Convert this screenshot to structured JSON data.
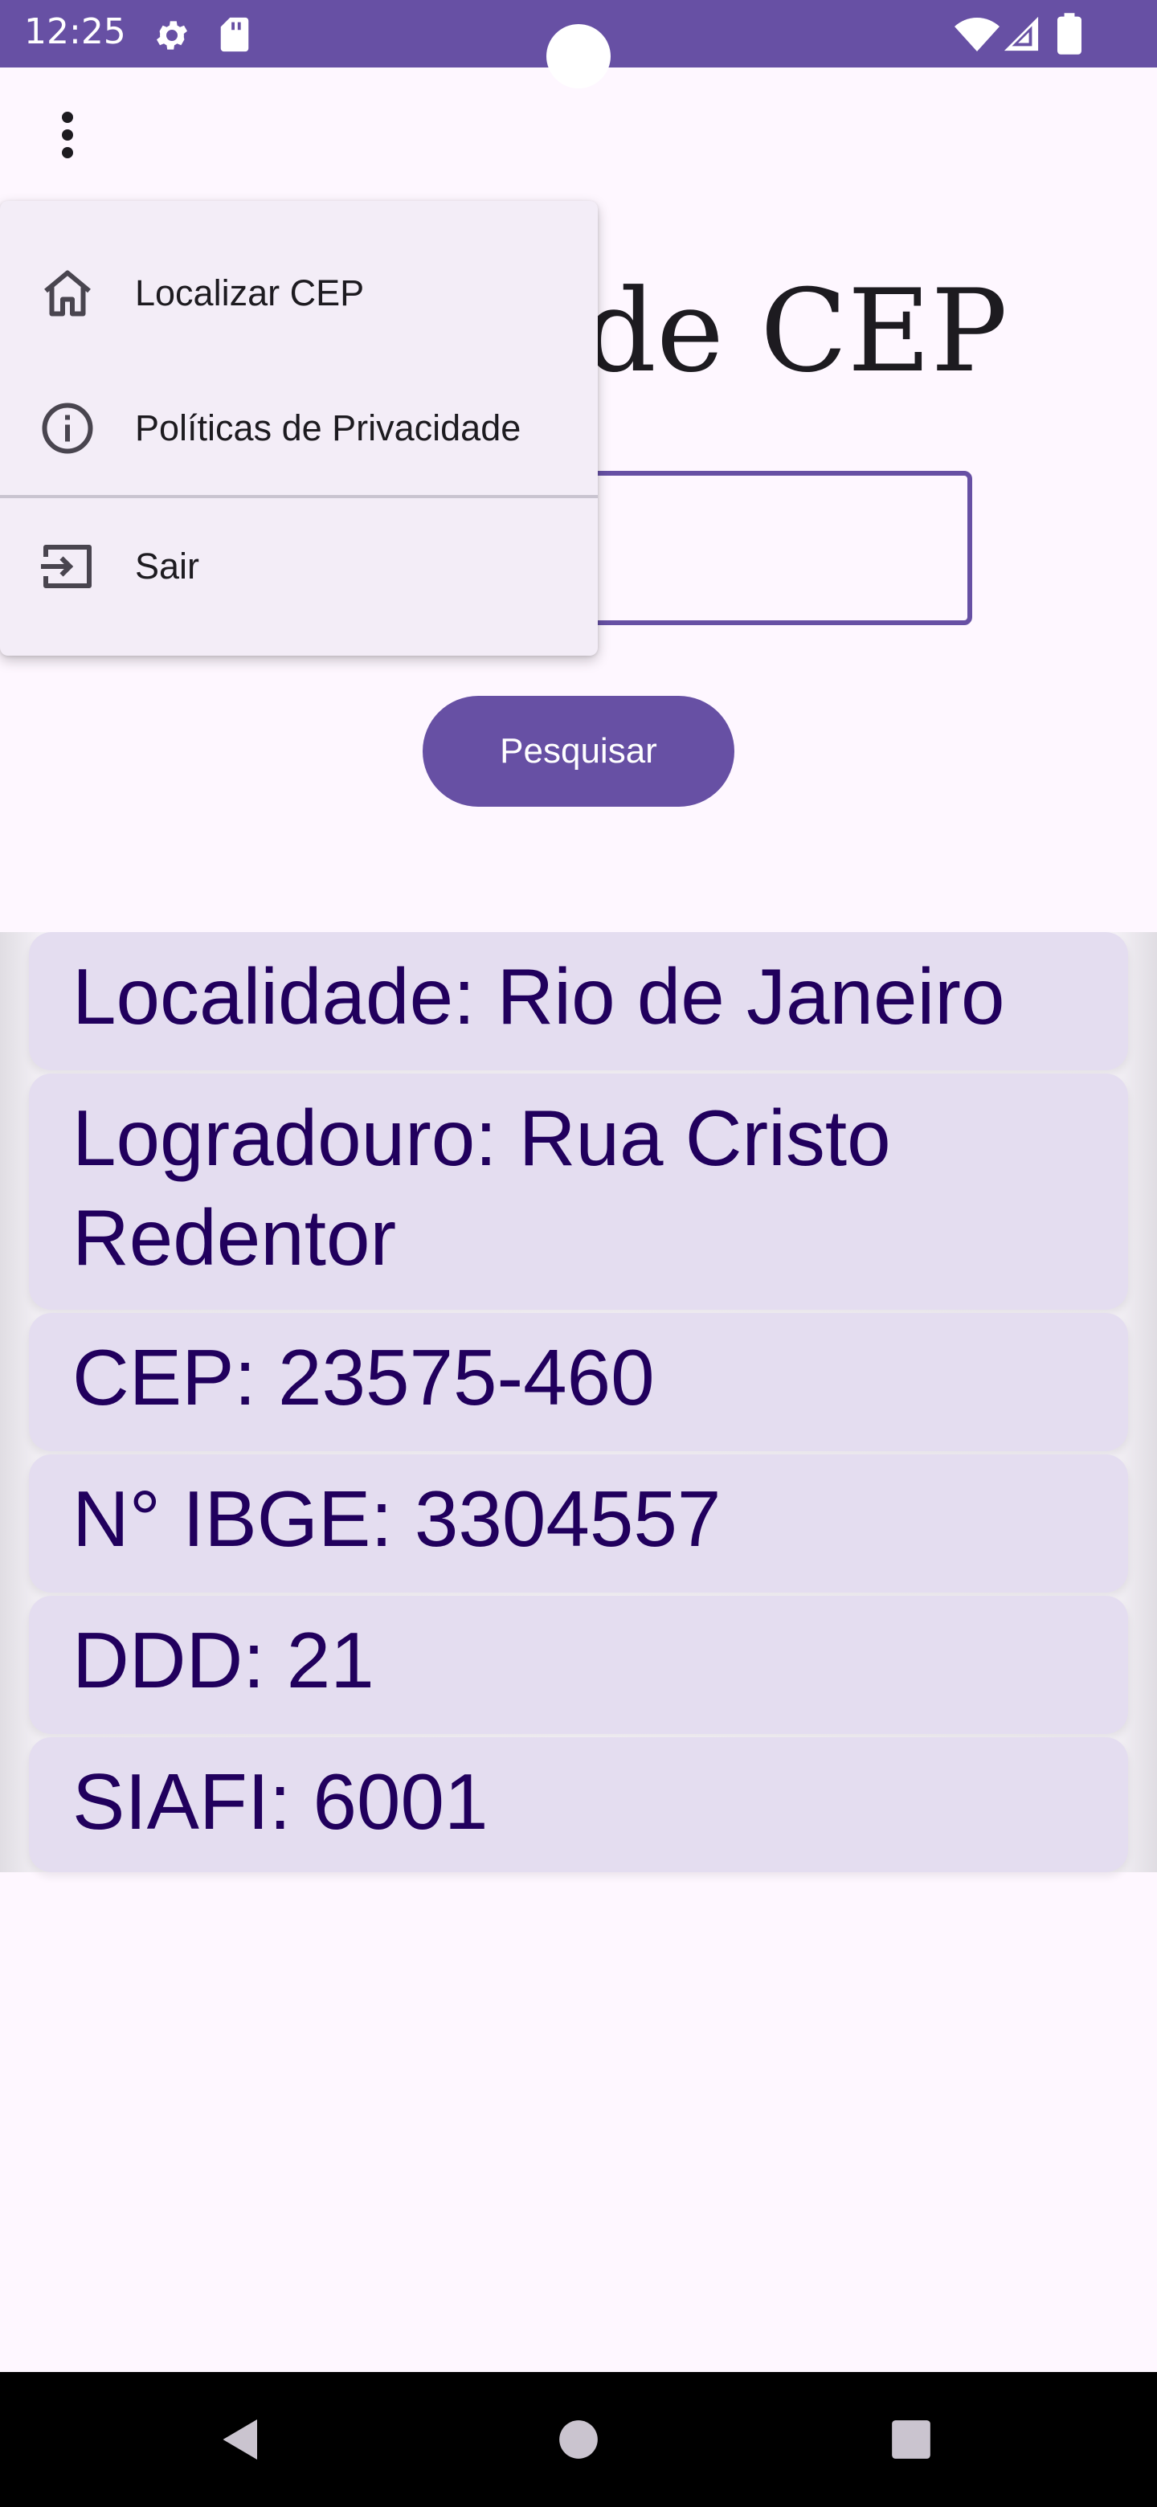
{
  "status_bar": {
    "time": "12:25",
    "icons": [
      "settings-icon",
      "sd-card-icon",
      "wifi-icon",
      "signal-icon",
      "battery-icon"
    ],
    "background": "#6750a4"
  },
  "app_bar": {
    "overflow_icon": "more-vert-icon"
  },
  "main": {
    "title": "a de CEP",
    "cep_input": {
      "value": "",
      "placeholder": ""
    },
    "search_button_label": "Pesquisar",
    "accent": "#6750a4"
  },
  "results": [
    {
      "text": "Localidade: Rio de Janeiro"
    },
    {
      "text": "Logradouro: Rua Cristo Redentor"
    },
    {
      "text": "CEP: 23575-460"
    },
    {
      "text": "N° IBGE: 3304557"
    },
    {
      "text": "DDD: 21"
    },
    {
      "text": "SIAFI: 6001"
    }
  ],
  "menu": {
    "items": [
      {
        "label": "Localizar CEP",
        "icon": "home-icon"
      },
      {
        "label": "Políticas de Privacidade",
        "icon": "info-icon"
      },
      {
        "label": "Sair",
        "icon": "logout-icon"
      }
    ]
  },
  "nav_bar": {
    "icons": [
      "back-icon",
      "home-circle-icon",
      "recents-icon"
    ]
  }
}
